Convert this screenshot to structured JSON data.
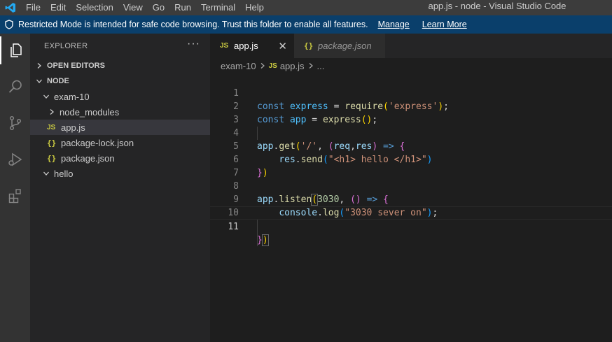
{
  "titlebar": {
    "menu": [
      "File",
      "Edit",
      "Selection",
      "View",
      "Go",
      "Run",
      "Terminal",
      "Help"
    ],
    "window_title": "app.js - node - Visual Studio Code"
  },
  "banner": {
    "message": "Restricted Mode is intended for safe code browsing. Trust this folder to enable all features.",
    "manage": "Manage",
    "learn_more": "Learn More"
  },
  "activity_bar": [
    "explorer-icon",
    "search-icon",
    "source-control-icon",
    "run-debug-icon",
    "extensions-icon"
  ],
  "sidebar": {
    "title": "EXPLORER",
    "more": "···",
    "open_editors": "OPEN EDITORS",
    "root": "NODE",
    "tree": [
      {
        "label": "exam-10",
        "kind": "folder-open"
      },
      {
        "label": "node_modules",
        "kind": "folder-closed"
      },
      {
        "label": "app.js",
        "kind": "js",
        "badge": "JS"
      },
      {
        "label": "package-lock.json",
        "kind": "json",
        "badge": "{}"
      },
      {
        "label": "package.json",
        "kind": "json",
        "badge": "{}"
      },
      {
        "label": "hello",
        "kind": "folder-open"
      }
    ]
  },
  "editor": {
    "tabs": [
      {
        "label": "app.js",
        "badge": "JS"
      },
      {
        "label": "package.json",
        "badge": "{}"
      }
    ],
    "close": "✕",
    "breadcrumb": [
      "exam-10",
      "JS",
      "app.js",
      "..."
    ],
    "line_numbers": [
      "1",
      "2",
      "3",
      "4",
      "5",
      "6",
      "7",
      "8",
      "9",
      "10",
      "11"
    ],
    "current_line": "11",
    "code": [
      "const express = require('express');",
      "const app = express();",
      "",
      "app.get('/', (req,res) => {",
      "    res.send(\"<h1> hello </h1>\")",
      "})",
      "",
      "app.listen(3030, () => {",
      "    console.log(\"3030 sever on\");",
      "",
      "})"
    ]
  },
  "colors": {
    "titlebar": "#3c3c3c",
    "banner": "#0a3f6b",
    "activity_bar": "#333333",
    "sidebar": "#252526",
    "editor": "#1e1e1e",
    "vscode_blue": "#23a9f2"
  }
}
